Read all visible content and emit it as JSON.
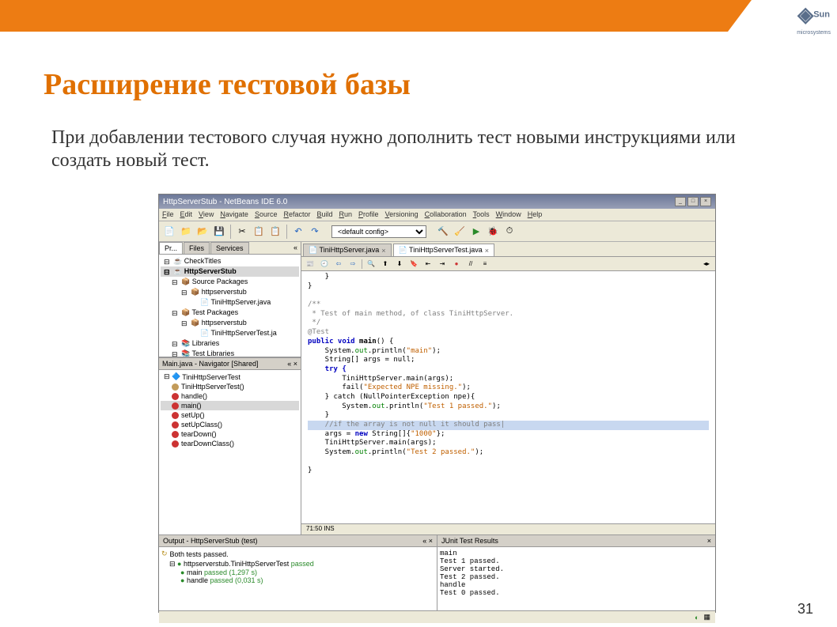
{
  "slide": {
    "title": "Расширение тестовой базы",
    "body": "При добавлении тестового случая нужно дополнить тест новыми инструкциями или создать новый тест.",
    "page_number": "31"
  },
  "brand": {
    "name": "Sun",
    "sub": "microsystems"
  },
  "ide": {
    "window_title": "HttpServerStub - NetBeans IDE 6.0",
    "menu": [
      "File",
      "Edit",
      "View",
      "Navigate",
      "Source",
      "Refactor",
      "Build",
      "Run",
      "Profile",
      "Versioning",
      "Collaboration",
      "Tools",
      "Window",
      "Help"
    ],
    "config_selected": "<default config>",
    "left_tabs": [
      "Pr...",
      "Files",
      "Services"
    ],
    "project_tree": [
      {
        "label": "CheckTitles",
        "lvl": 0,
        "icon": "☕"
      },
      {
        "label": "HttpServerStub",
        "lvl": 0,
        "icon": "☕",
        "sel": true
      },
      {
        "label": "Source Packages",
        "lvl": 1,
        "icon": "📦"
      },
      {
        "label": "httpserverstub",
        "lvl": 2,
        "icon": "📦"
      },
      {
        "label": "TiniHttpServer.java",
        "lvl": 3,
        "icon": "📄"
      },
      {
        "label": "Test Packages",
        "lvl": 1,
        "icon": "📦"
      },
      {
        "label": "httpserverstub",
        "lvl": 2,
        "icon": "📦"
      },
      {
        "label": "TiniHttpServerTest.ja",
        "lvl": 3,
        "icon": "📄"
      },
      {
        "label": "Libraries",
        "lvl": 1,
        "icon": "📚"
      },
      {
        "label": "Test Libraries",
        "lvl": 1,
        "icon": "📚"
      }
    ],
    "navigator_title": "Main.java - Navigator [Shared]",
    "navigator_root": "TiniHttpServerTest",
    "nav_items": [
      {
        "label": "TiniHttpServerTest()",
        "cls": "tan"
      },
      {
        "label": "handle()",
        "cls": "red"
      },
      {
        "label": "main()",
        "cls": "red",
        "sel": true
      },
      {
        "label": "setUp()",
        "cls": "red"
      },
      {
        "label": "setUpClass()",
        "cls": "red"
      },
      {
        "label": "tearDown()",
        "cls": "red"
      },
      {
        "label": "tearDownClass()",
        "cls": "red"
      }
    ],
    "editor_tabs": [
      {
        "label": "TiniHttpServer.java",
        "active": false
      },
      {
        "label": "TiniHttpServerTest.java",
        "active": true
      }
    ],
    "editor_status": "71:50   INS",
    "code": {
      "l1": "    }",
      "l2": "}",
      "c1": "/**",
      "c2": " * Test of main method, of class TiniHttpServer.",
      "c3": " */",
      "ann": "@Test",
      "sig_kw": "public void",
      "sig_name": "main",
      "sig_rest": "() {",
      "p1a": "    System.",
      "p1b": "out",
      "p1c": ".println(",
      "p1s": "\"main\"",
      "p1d": ");",
      "p2": "    String[] args = null;",
      "p3": "    try {",
      "p4": "        TiniHttpServer.main(args);",
      "p5a": "        fail(",
      "p5s": "\"Expected NPE missing.\"",
      "p5b": ");",
      "p6": "    } catch (NullPointerException npe){",
      "p7a": "        System.",
      "p7b": "out",
      "p7c": ".println(",
      "p7s": "\"Test 1 passed.\"",
      "p7d": ");",
      "p8": "    }",
      "hl": "    //if the array is not null it should pass|",
      "p9a": "    args = ",
      "p9kw": "new",
      "p9b": " String[]{",
      "p9s": "\"1000\"",
      "p9c": "};",
      "p10": "    TiniHttpServer.main(args);",
      "p11a": "    System.",
      "p11b": "out",
      "p11c": ".println(",
      "p11s": "\"Test 2 passed.\"",
      "p11d": ");",
      "end": "}"
    },
    "output_title": "Output - HttpServerStub (test)",
    "junit_title": "JUnit Test Results",
    "output_summary": "Both tests passed.",
    "output_tree": [
      {
        "label": "httpserverstub.TiniHttpServerTest",
        "status": "passed",
        "lvl": 0
      },
      {
        "label": "main",
        "status": "passed (1,297 s)",
        "lvl": 1
      },
      {
        "label": "handle",
        "status": "passed (0,031 s)",
        "lvl": 1
      }
    ],
    "junit_lines": [
      "main",
      "Test 1 passed.",
      "Server started.",
      "Test 2 passed.",
      "handle",
      "Test 0 passed."
    ]
  }
}
